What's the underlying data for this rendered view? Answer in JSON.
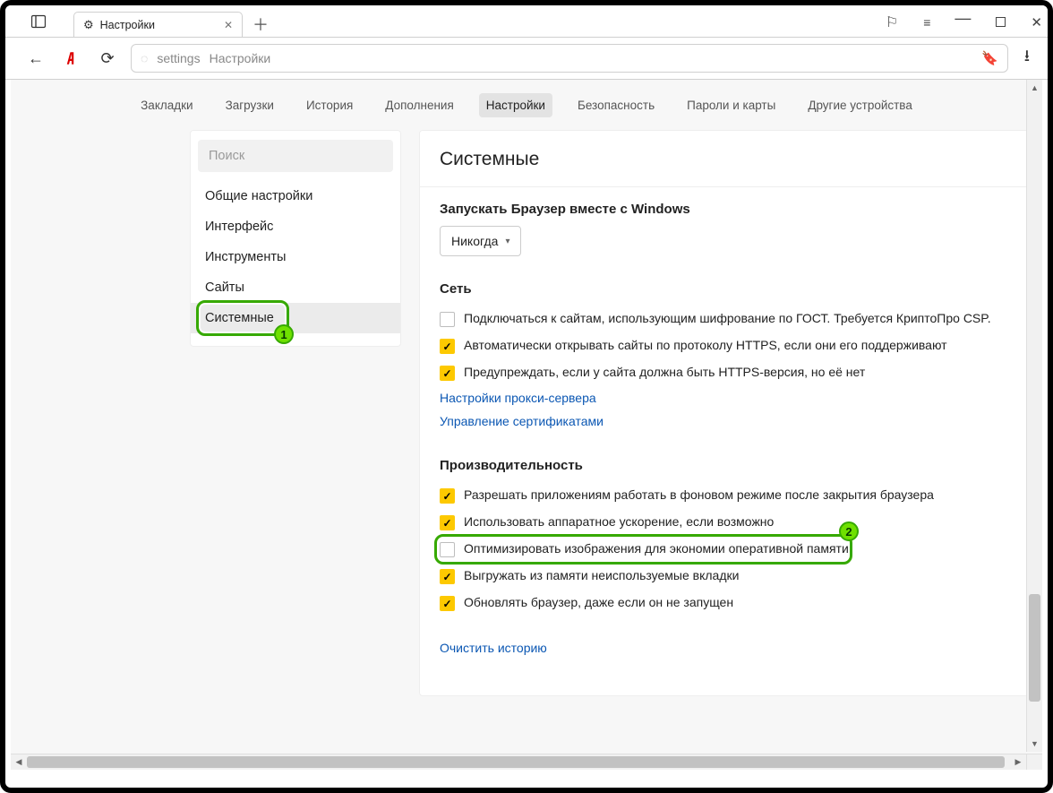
{
  "tab": {
    "title": "Настройки"
  },
  "address": {
    "url_a": "settings",
    "url_b": "Настройки"
  },
  "topnav": {
    "items": [
      "Закладки",
      "Загрузки",
      "История",
      "Дополнения",
      "Настройки",
      "Безопасность",
      "Пароли и карты",
      "Другие устройства"
    ],
    "active_index": 4
  },
  "sidebar": {
    "search_placeholder": "Поиск",
    "items": [
      "Общие настройки",
      "Интерфейс",
      "Инструменты",
      "Сайты",
      "Системные"
    ],
    "selected_index": 4
  },
  "panel": {
    "title": "Системные",
    "section_startup": {
      "heading": "Запускать Браузер вместе с Windows",
      "dropdown_value": "Никогда"
    },
    "section_network": {
      "heading": "Сеть",
      "rows": [
        {
          "checked": false,
          "label": "Подключаться к сайтам, использующим шифрование по ГОСТ. Требуется КриптоПро CSP."
        },
        {
          "checked": true,
          "label": "Автоматически открывать сайты по протоколу HTTPS, если они его поддерживают"
        },
        {
          "checked": true,
          "label": "Предупреждать, если у сайта должна быть HTTPS-версия, но её нет"
        }
      ],
      "links": [
        "Настройки прокси-сервера",
        "Управление сертификатами"
      ]
    },
    "section_perf": {
      "heading": "Производительность",
      "rows": [
        {
          "checked": true,
          "label": "Разрешать приложениям работать в фоновом режиме после закрытия браузера"
        },
        {
          "checked": true,
          "label": "Использовать аппаратное ускорение, если возможно"
        },
        {
          "checked": false,
          "label": "Оптимизировать изображения для экономии оперативной памяти"
        },
        {
          "checked": true,
          "label": "Выгружать из памяти неиспользуемые вкладки"
        },
        {
          "checked": true,
          "label": "Обновлять браузер, даже если он не запущен"
        }
      ]
    },
    "link_clear_history": "Очистить историю"
  },
  "annotations": {
    "badge1": "1",
    "badge2": "2"
  }
}
